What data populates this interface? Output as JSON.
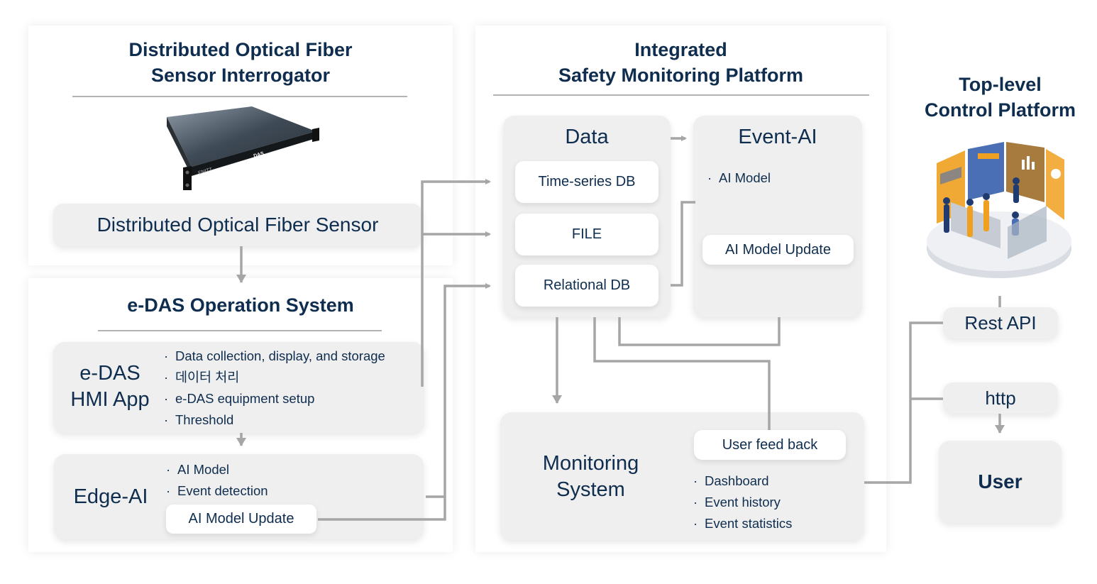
{
  "interrogator": {
    "title_line1": "Distributed Optical Fiber",
    "title_line2": "Sensor Interrogator",
    "device_brand": "ENITT",
    "device_label": "DAS",
    "sensor_label": "Distributed Optical Fiber Sensor"
  },
  "operation_system": {
    "title": "e-DAS Operation System",
    "hmi_app": {
      "title_line1": "e-DAS",
      "title_line2": "HMI App",
      "items": [
        "Data collection, display, and storage",
        "데이터 처리",
        "e-DAS equipment setup",
        "Threshold"
      ]
    },
    "edge_ai": {
      "title": "Edge-AI",
      "items": [
        "AI Model",
        "Event detection"
      ],
      "update_label": "AI Model Update"
    }
  },
  "platform": {
    "title_line1": "Integrated",
    "title_line2": "Safety Monitoring Platform",
    "data": {
      "title": "Data",
      "stores": [
        "Time-series DB",
        "FILE",
        "Relational DB"
      ]
    },
    "event_ai": {
      "title": "Event-AI",
      "items": [
        "AI Model"
      ],
      "update_label": "AI Model Update"
    },
    "monitoring": {
      "title_line1": "Monitoring",
      "title_line2": "System",
      "feedback_label": "User feed back",
      "items": [
        "Dashboard",
        "Event history",
        "Event statistics"
      ]
    }
  },
  "control_platform": {
    "title_line1": "Top-level",
    "title_line2": "Control Platform",
    "rest_api": "Rest API",
    "http": "http",
    "user": "User"
  },
  "bullet_glyph": "·",
  "colors": {
    "text": "#0f2d4e",
    "card": "#efefef",
    "connector": "#a6a6a6",
    "divider": "#b3b3b3",
    "accent_orange": "#f0a020",
    "accent_blue": "#4a6fb5"
  }
}
